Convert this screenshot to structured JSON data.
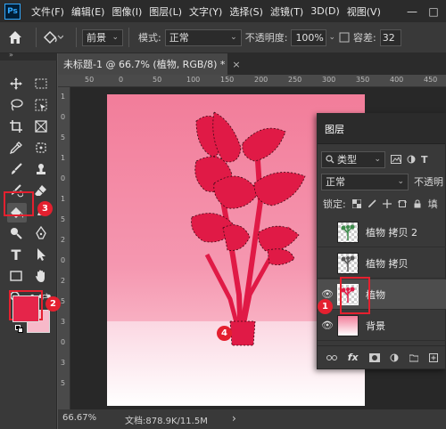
{
  "menu": {
    "items": [
      "文件(F)",
      "编辑(E)",
      "图像(I)",
      "图层(L)",
      "文字(Y)",
      "选择(S)",
      "滤镜(T)",
      "3D(D)",
      "视图(V)"
    ],
    "logo": "Ps",
    "minimize": "—",
    "restore": "□"
  },
  "options": {
    "fill_source": "前景",
    "mode_label": "模式:",
    "mode_value": "正常",
    "opacity_label": "不透明度:",
    "opacity_value": "100%",
    "tolerance_label": "容差:",
    "tolerance_value": "32"
  },
  "document": {
    "tab_title": "未标题-1 @ 66.7% (植物, RGB/8) *",
    "close_glyph": "×",
    "ruler_h": [
      "50",
      "0",
      "50",
      "100",
      "150",
      "200",
      "250",
      "300",
      "350",
      "400",
      "450"
    ],
    "ruler_v": [
      "1",
      "0",
      "5",
      "1",
      "0",
      "1",
      "5",
      "2",
      "0",
      "2",
      "5",
      "3",
      "0",
      "3",
      "5"
    ]
  },
  "status": {
    "zoom": "66.67%",
    "doc_info": "文档:878.9K/11.5M",
    "nav_arrow": "›"
  },
  "colors": {
    "foreground": "#e5254a",
    "background": "#f7b9c9",
    "plant": "#e01a46",
    "callout_red": "#e4202f"
  },
  "layers_panel": {
    "title": "图层",
    "filter_label": "类型",
    "blend_mode": "正常",
    "opacity_label": "不透明",
    "lock_label": "锁定:",
    "fill_label": "填",
    "layers": [
      {
        "name": "植物 拷贝 2",
        "visible": false,
        "selected": false
      },
      {
        "name": "植物 拷贝",
        "visible": false,
        "selected": false
      },
      {
        "name": "植物",
        "visible": true,
        "selected": true
      },
      {
        "name": "背景",
        "visible": true,
        "selected": false
      }
    ]
  },
  "callouts": [
    "1",
    "2",
    "3",
    "4"
  ]
}
